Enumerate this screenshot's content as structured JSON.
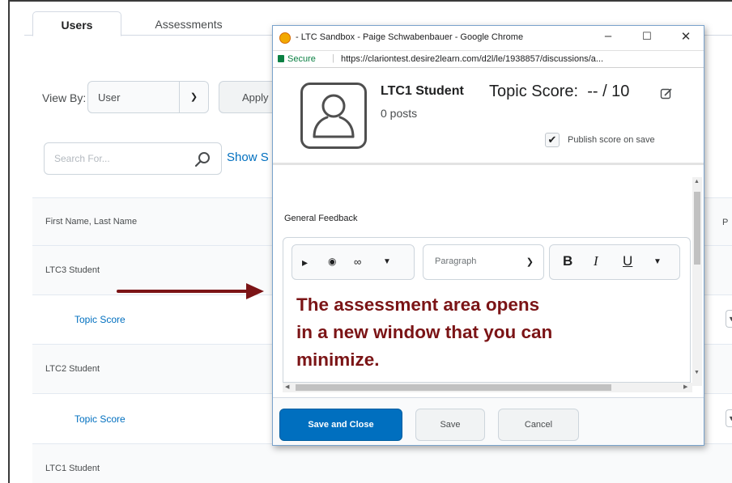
{
  "tabs": [
    "Users",
    "Assessments"
  ],
  "filters": {
    "view_by_label": "View By:",
    "view_by_value": "User",
    "apply_label": "Apply",
    "search_placeholder": "Search For...",
    "show_link": "Show S"
  },
  "table": {
    "header_first": "First Name, Last Name",
    "header_right_partial": "P",
    "rows": [
      {
        "kind": "student",
        "text": "LTC3 Student"
      },
      {
        "kind": "score",
        "text": "Topic Score"
      },
      {
        "kind": "student",
        "text": "LTC2 Student"
      },
      {
        "kind": "score",
        "text": "Topic Score"
      },
      {
        "kind": "student",
        "text": "LTC1 Student"
      }
    ]
  },
  "popup": {
    "window_title": "- LTC Sandbox - Paige Schwabenbauer - Google Chrome",
    "secure_label": "Secure",
    "url": "https://clariontest.desire2learn.com/d2l/le/1938857/discussions/a...",
    "student_name": "LTC1 Student",
    "posts": "0 posts",
    "topic_score_label": "Topic Score:",
    "score_value": "-- / 10",
    "publish_label": "Publish score on save",
    "general_feedback_label": "General Feedback",
    "paragraph_value": "Paragraph",
    "save_close_label": "Save and Close",
    "save_label": "Save",
    "cancel_label": "Cancel"
  },
  "annotation": {
    "line1": "The assessment area opens",
    "line2": "in a new window that you can",
    "line3": "minimize.",
    "color": "#7b1416"
  },
  "icons": [
    "search-icon",
    "chevron-down-icon",
    "user-avatar-icon",
    "pencil-icon",
    "checkmark-icon",
    "video-icon",
    "camera-icon",
    "link-icon",
    "bold-icon",
    "italic-icon",
    "underline-icon",
    "arrow-right-icon"
  ]
}
